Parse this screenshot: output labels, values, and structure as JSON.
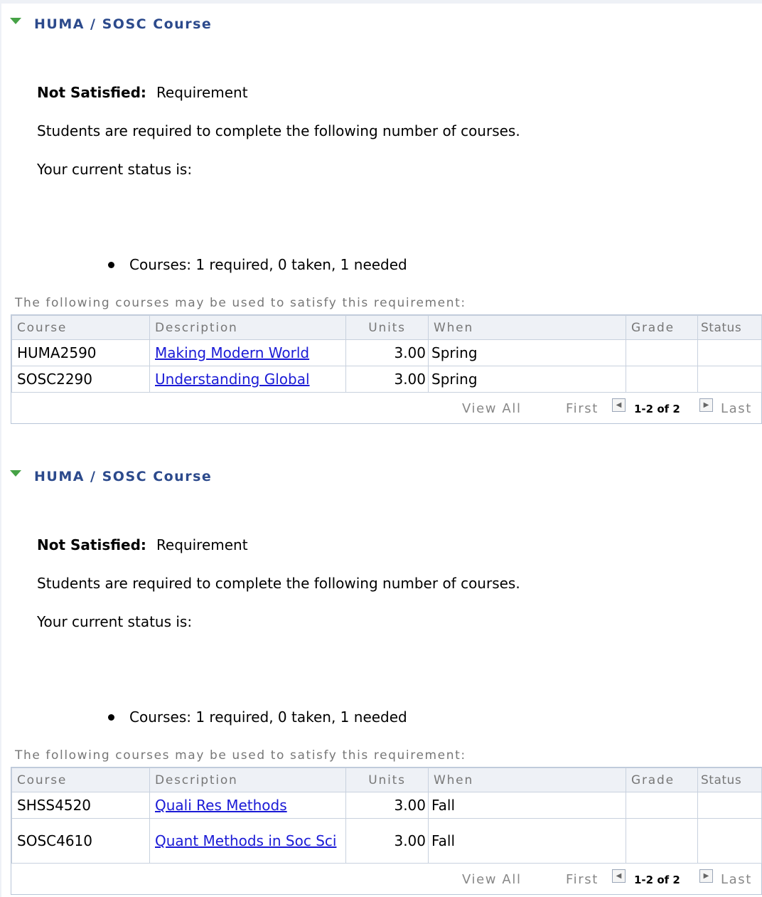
{
  "sections": [
    {
      "title": "HUMA / SOSC Course",
      "status_label": "Not Satisfied:",
      "status_value": "Requirement",
      "description": "Students are required to complete the following number of courses.",
      "current_status": "Your current status is:",
      "bullet": "Courses: 1 required, 0 taken, 1 needed",
      "note": "The following courses may be used to satisfy this requirement:",
      "columns": [
        "Course",
        "Description",
        "Units",
        "When",
        "Grade",
        "Status"
      ],
      "rows": [
        {
          "course": "HUMA2590",
          "description": "Making Modern World",
          "units": "3.00",
          "when": "Spring",
          "grade": "",
          "status": ""
        },
        {
          "course": "SOSC2290",
          "description": "Understanding Global",
          "units": "3.00",
          "when": "Spring",
          "grade": "",
          "status": ""
        }
      ],
      "footer": {
        "view_all": "View All",
        "first": "First",
        "range": "1-2 of 2",
        "last": "Last",
        "prev_icon": "left-arrow",
        "next_icon": "right-arrow"
      }
    },
    {
      "title": "HUMA / SOSC Course",
      "status_label": "Not Satisfied:",
      "status_value": "Requirement",
      "description": "Students are required to complete the following number of courses.",
      "current_status": "Your current status is:",
      "bullet": "Courses: 1 required, 0 taken, 1 needed",
      "note": "The following courses may be used to satisfy this requirement:",
      "columns": [
        "Course",
        "Description",
        "Units",
        "When",
        "Grade",
        "Status"
      ],
      "rows": [
        {
          "course": "SHSS4520",
          "description": "Quali Res Methods",
          "units": "3.00",
          "when": "Fall",
          "grade": "",
          "status": ""
        },
        {
          "course": "SOSC4610",
          "description": "Quant Methods in Soc Sci",
          "units": "3.00",
          "when": "Fall",
          "grade": "",
          "status": ""
        }
      ],
      "footer": {
        "view_all": "View All",
        "first": "First",
        "range": "1-2 of 2",
        "last": "Last",
        "prev_icon": "left-arrow",
        "next_icon": "right-arrow"
      }
    }
  ],
  "colors": {
    "header_text": "#2c4a8c",
    "triangle": "#46a246",
    "link": "#1a1ad6",
    "grid_border": "#b9c6d8"
  }
}
